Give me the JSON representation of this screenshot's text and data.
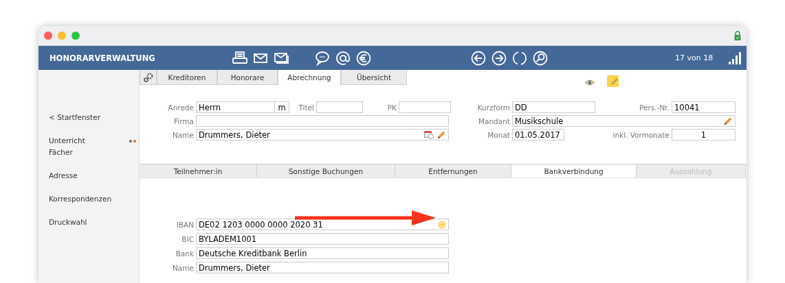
{
  "toolbar": {
    "title": "HONORARVERWALTUNG",
    "counter": "17 von 18"
  },
  "sidebar": {
    "items": [
      {
        "label": "< Startfenster",
        "dots": false
      },
      {
        "label": "Unterricht",
        "dots": true
      },
      {
        "label": "Fächer",
        "dots": false
      },
      {
        "label": "Adresse",
        "dots": false
      },
      {
        "label": "Korrespondenzen",
        "dots": false
      },
      {
        "label": "Druckwahl",
        "dots": false
      }
    ]
  },
  "top_tabs": [
    {
      "label": "Kreditoren",
      "selected": false
    },
    {
      "label": "Honorare",
      "selected": false
    },
    {
      "label": "Abrechnung",
      "selected": true
    },
    {
      "label": "Übersicht",
      "selected": false
    }
  ],
  "header_form": {
    "anrede": {
      "label": "Anrede",
      "value": "Herrn",
      "suffix": "m"
    },
    "titel": {
      "label": "Titel"
    },
    "pk": {
      "label": "PK"
    },
    "firma": {
      "label": "Firma"
    },
    "name": {
      "label": "Name",
      "value": "Drummers, Dieter"
    },
    "kurzform": {
      "label": "Kurzform",
      "value": "DD"
    },
    "pers_nr": {
      "label": "Pers.-Nr.",
      "value": "10041"
    },
    "mandant": {
      "label": "Mandant",
      "value": "Musikschule"
    },
    "monat": {
      "label": "Monat",
      "value": "01.05.2017"
    },
    "vormonate": {
      "label": "inkl. Vormonate",
      "value": "1"
    }
  },
  "sub_tabs": [
    {
      "label": "Teilnehmer:in",
      "selected": false,
      "disabled": false
    },
    {
      "label": "Sonstige Buchungen",
      "selected": false,
      "disabled": false
    },
    {
      "label": "Entfernungen",
      "selected": false,
      "disabled": false
    },
    {
      "label": "Bankverbindung",
      "selected": true,
      "disabled": false
    },
    {
      "label": "Auszahlung",
      "selected": false,
      "disabled": true
    }
  ],
  "bank_fields": [
    {
      "label": "IBAN",
      "value": "DE02 1203 0000 0000 2020 31",
      "kind": "refresh"
    },
    {
      "label": "BIC",
      "value": "BYLADEM1001",
      "kind": "plain"
    },
    {
      "label": "Bank",
      "value": "Deutsche Kreditbank Berlin",
      "kind": "plain"
    },
    {
      "label": "Name",
      "value": "Drummers, Dieter",
      "kind": "plain"
    }
  ]
}
